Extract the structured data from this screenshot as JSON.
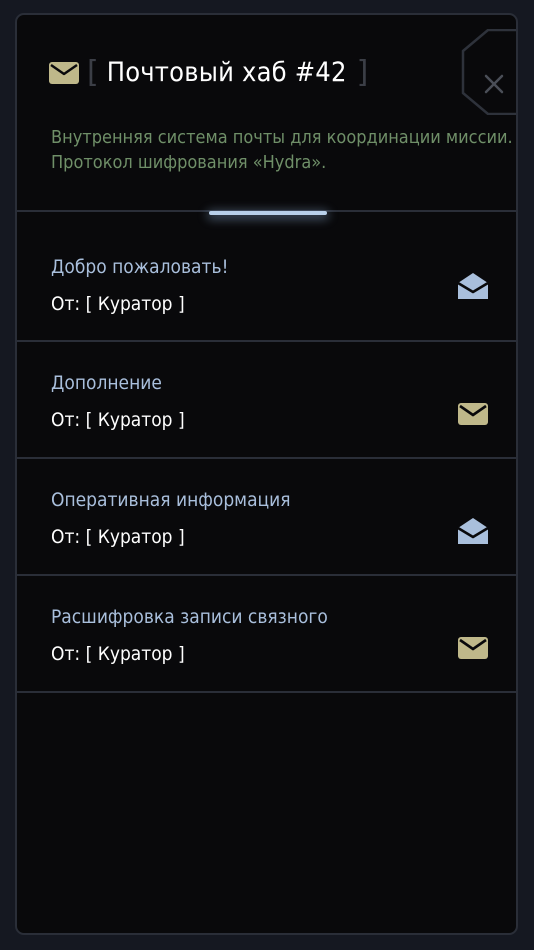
{
  "header": {
    "title": "Почтовый хаб #42",
    "bracket_open": "[",
    "bracket_close": "]",
    "description": "Внутренняя система почты для координации миссии. Протокол шифрования «Hydra»."
  },
  "messages": [
    {
      "subject": "Добро пожаловать!",
      "from": "От: [ Куратор ]",
      "status": "read",
      "icon": "mail-open-icon"
    },
    {
      "subject": "Дополнение",
      "from": "От: [ Куратор ]",
      "status": "unread",
      "icon": "mail-closed-icon"
    },
    {
      "subject": "Оперативная информация",
      "from": "От: [ Куратор ]",
      "status": "read",
      "icon": "mail-open-icon"
    },
    {
      "subject": "Расшифровка записи связного",
      "from": "От: [ Куратор ]",
      "status": "unread",
      "icon": "mail-closed-icon"
    }
  ],
  "colors": {
    "read_icon": "#a9bfdc",
    "unread_icon": "#bfb88a",
    "description": "#6f8f68",
    "subject": "#a9bfdc"
  }
}
